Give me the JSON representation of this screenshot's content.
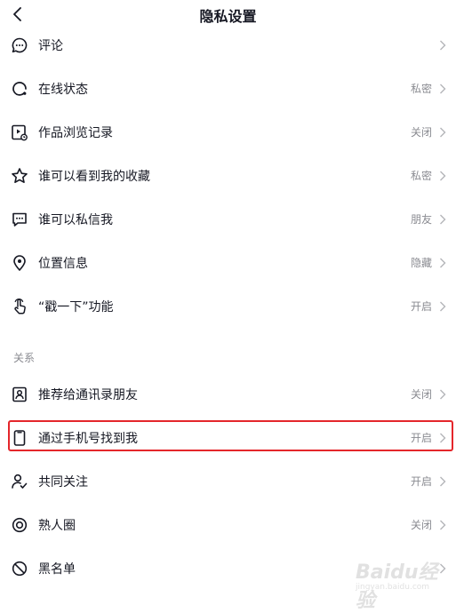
{
  "header": {
    "title": "隐私设置"
  },
  "items": [
    {
      "label": "评论",
      "value": ""
    },
    {
      "label": "在线状态",
      "value": "私密"
    },
    {
      "label": "作品浏览记录",
      "value": "关闭"
    },
    {
      "label": "谁可以看到我的收藏",
      "value": "私密"
    },
    {
      "label": "谁可以私信我",
      "value": "朋友"
    },
    {
      "label": "位置信息",
      "value": "隐藏"
    },
    {
      "label": "“戳一下”功能",
      "value": "开启"
    }
  ],
  "section_relations": {
    "title": "关系"
  },
  "relation_items": [
    {
      "label": "推荐给通讯录朋友",
      "value": "关闭"
    },
    {
      "label": "通过手机号找到我",
      "value": "开启"
    },
    {
      "label": "共同关注",
      "value": "开启"
    },
    {
      "label": "熟人圈",
      "value": "关闭"
    },
    {
      "label": "黑名单",
      "value": ""
    }
  ],
  "watermark": {
    "brand": "Baidu经验",
    "url": "jingyan.baidu.com"
  },
  "colors": {
    "text": "#161823",
    "secondary": "#8a8b91",
    "highlight": "#e4262b"
  }
}
